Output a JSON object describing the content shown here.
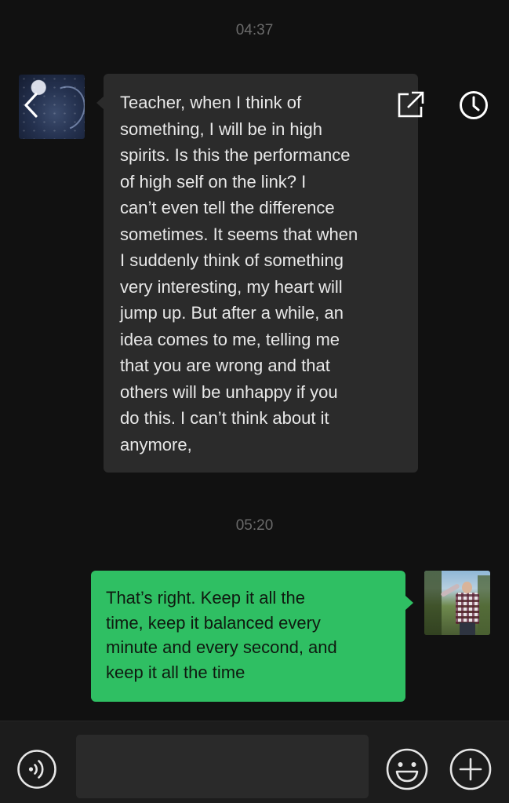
{
  "timestamps": [
    "04:37",
    "05:20"
  ],
  "messages": [
    {
      "sender": "teacher",
      "text": "Teacher, when I think of\nsomething, I will be in high\nspirits. Is this the performance\n of high self on the link? I\ncan’t even tell the difference\nsometimes. It seems that when\nI suddenly think of something\nvery interesting, my heart will\njump up. But after a while, an\nidea comes to me, telling me\nthat you are wrong and that\nothers will be unhappy if you\ndo this. I can’t think about it\nanymore,"
    },
    {
      "sender": "me",
      "text": "That’s right. Keep it all the\ntime, keep it balanced every\nminute and every second, and\nkeep it all the time"
    }
  ],
  "input": {
    "value": "",
    "placeholder": ""
  },
  "icons": {
    "back": "chevron-left-icon",
    "share": "external-link-icon",
    "history": "clock-icon",
    "voice": "voice-wave-icon",
    "emoji": "smiley-face-icon",
    "plus": "plus-circle-icon"
  },
  "colors": {
    "background": "#111111",
    "incoming_bubble": "#2b2b2b",
    "outgoing_bubble": "#2fbf63",
    "input_bar": "#1c1c1c",
    "timestamp": "#6a6a6a"
  }
}
